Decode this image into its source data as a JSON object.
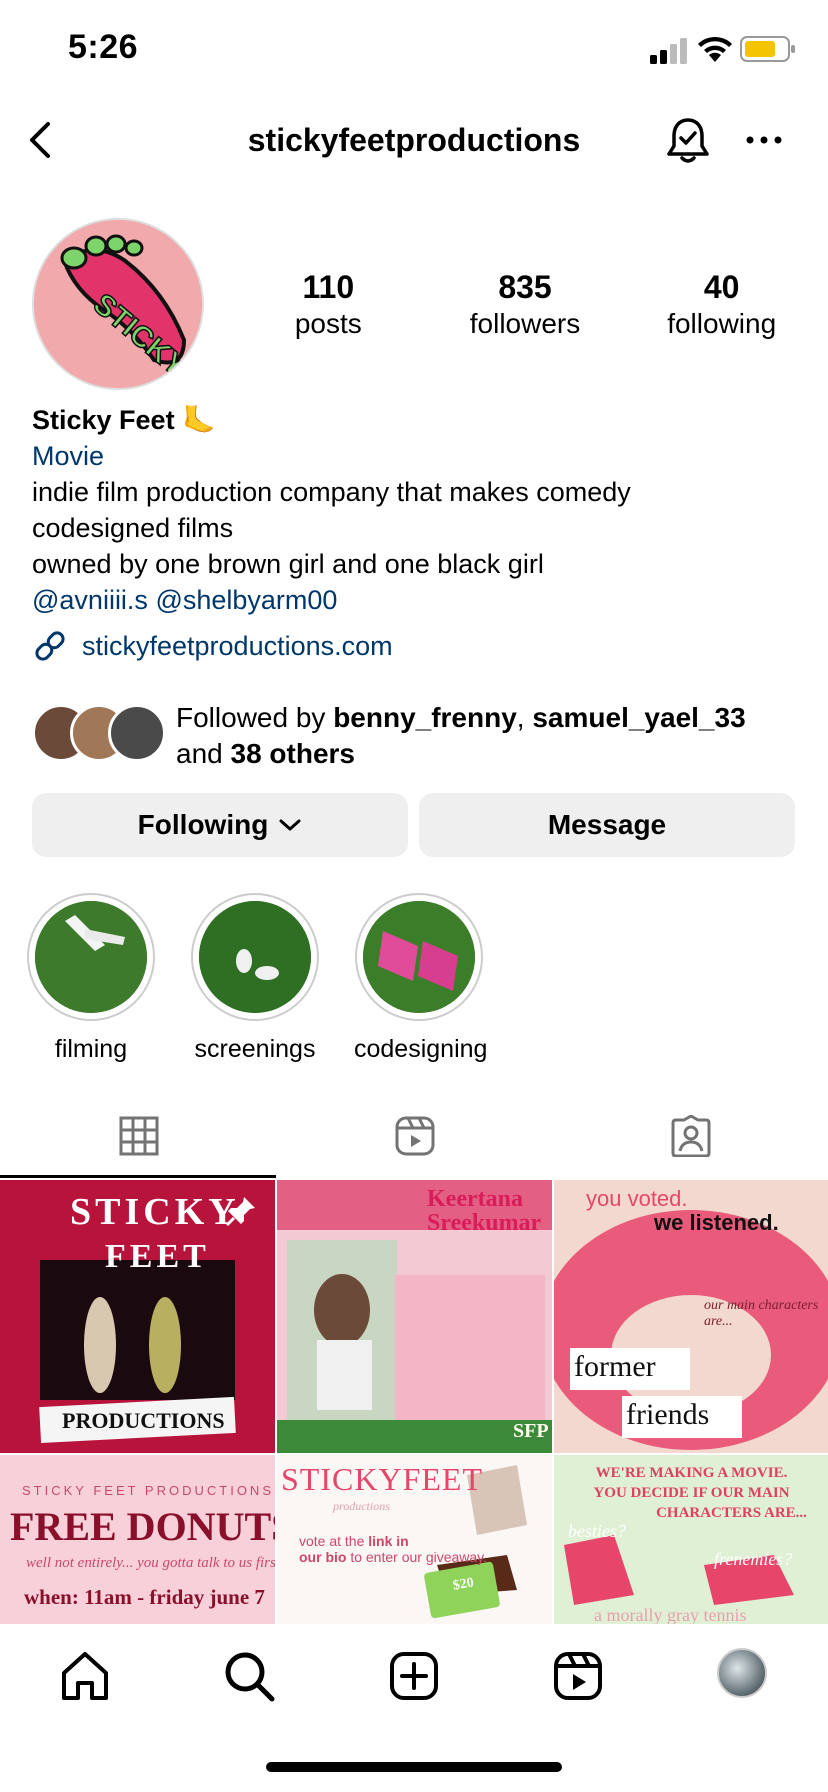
{
  "status_bar": {
    "time": "5:26"
  },
  "header": {
    "username": "stickyfeetproductions"
  },
  "avatar_text": "STICKY",
  "stats": [
    {
      "value": "110",
      "label": "posts"
    },
    {
      "value": "835",
      "label": "followers"
    },
    {
      "value": "40",
      "label": "following"
    }
  ],
  "bio": {
    "name": "Sticky Feet 🦶",
    "category": "Movie",
    "lines": [
      "indie film production company that makes comedy",
      "codesigned films",
      "owned by one brown girl and one black girl"
    ],
    "mentions": "@avniiii.s @shelbyarm00",
    "website": "stickyfeetproductions.com"
  },
  "followed_by": {
    "prefix": "Followed by ",
    "user1": "benny_frenny",
    "sep": ", ",
    "user2": "samuel_yael_33",
    "and": "and ",
    "others": "38 others"
  },
  "buttons": {
    "following": "Following",
    "message": "Message"
  },
  "highlights": [
    {
      "label": "filming"
    },
    {
      "label": "screenings"
    },
    {
      "label": "codesigning"
    }
  ],
  "posts": {
    "p1": {
      "line1": "STICKY",
      "line2": "FEET",
      "line3": "PRODUCTIONS"
    },
    "p2": {
      "title1": "Keertana",
      "title2": "Sreekumar",
      "badge": "SFP"
    },
    "p3": {
      "top1": "you voted.",
      "top2": "we listened.",
      "mid": "our main characters are...",
      "w1": "former",
      "w2": "friends"
    },
    "p4": {
      "top": "STICKY FEET PRODUCTIONS",
      "title": "FREE DONUTS",
      "sub": "well not entirely... you gotta talk to us first",
      "when": "when: 11am - friday june 7"
    },
    "p5": {
      "title": "STICKYFEET",
      "sub": "productions",
      "body1": "vote at the",
      "link": "link in",
      "body2": "our bio",
      "body3": "to enter our giveaway.",
      "card": "$20"
    },
    "p6": {
      "line1": "WE'RE MAKING A MOVIE.",
      "line2": "YOU DECIDE IF OUR MAIN",
      "line3": "CHARACTERS ARE...",
      "opt1": "besties?",
      "opt2": "frenemies?",
      "bottom": "a morally gray tennis"
    }
  },
  "colors": {
    "link": "#00376b",
    "button_bg": "#efefef",
    "accent_pink": "#e8456b",
    "battery": "#f5c400"
  }
}
